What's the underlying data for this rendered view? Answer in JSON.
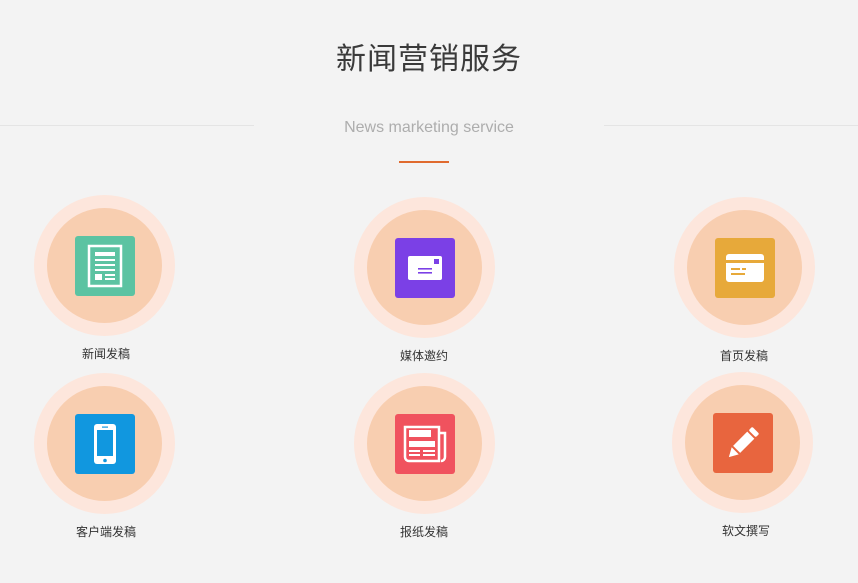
{
  "header": {
    "title": "新闻营销服务",
    "subtitle": "News marketing service"
  },
  "services": [
    {
      "label": "新闻发稿",
      "icon": "document-icon",
      "color": "#5cc3a2"
    },
    {
      "label": "媒体邀约",
      "icon": "envelope-icon",
      "color": "#7b40e6"
    },
    {
      "label": "首页发稿",
      "icon": "card-icon",
      "color": "#e7a93a"
    },
    {
      "label": "客户端发稿",
      "icon": "mobile-phone-icon",
      "color": "#1197df"
    },
    {
      "label": "报纸发稿",
      "icon": "newspaper-icon",
      "color": "#f0525e"
    },
    {
      "label": "软文撰写",
      "icon": "pencil-icon",
      "color": "#e8653e"
    }
  ]
}
